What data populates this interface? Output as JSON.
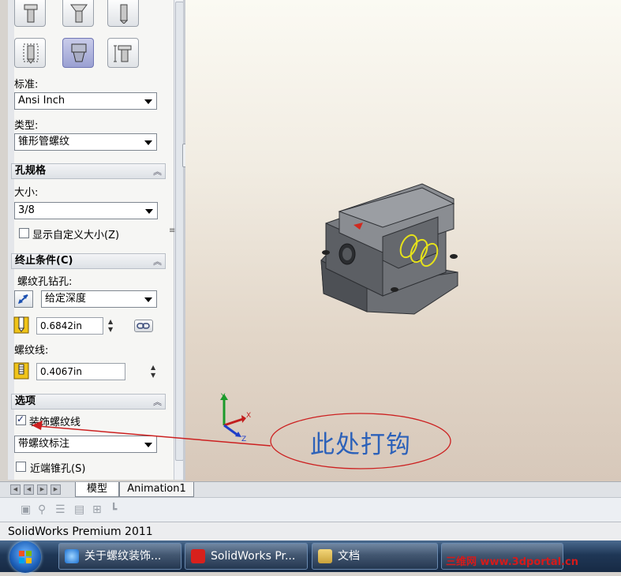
{
  "property_manager": {
    "standard_label": "标准:",
    "standard_value": "Ansi Inch",
    "type_label": "类型:",
    "type_value": "锥形管螺纹",
    "hole_spec": {
      "title": "孔规格",
      "size_label": "大小:",
      "size_value": "3/8",
      "custom_size_label": "显示自定义大小(Z)",
      "custom_size_checked": false
    },
    "end_condition": {
      "title": "终止条件(C)",
      "drill_label": "螺纹孔钻孔:",
      "drill_value": "给定深度",
      "drill_depth": "0.6842in",
      "thread_label": "螺纹线:",
      "thread_depth": "0.4067in"
    },
    "options": {
      "title": "选项",
      "cosmetic_thread_label": "装饰螺纹线",
      "cosmetic_thread_checked": true,
      "callout_value": "带螺纹标注",
      "near_csk_label": "近端锥孔(S)",
      "near_csk_checked": false
    }
  },
  "annotation": {
    "text": "此处打钩",
    "color": "#2c61b9",
    "stroke_color": "#cc2020"
  },
  "axes": {
    "x": "X",
    "y": "Y",
    "z": "Z"
  },
  "tabs": [
    {
      "label": "模型",
      "active": true
    },
    {
      "label": "Animation1",
      "active": false
    }
  ],
  "status_bar": {
    "text": "SolidWorks Premium 2011"
  },
  "taskbar": {
    "items": [
      {
        "label": "关于螺纹装饰...",
        "icon": "ie-icon"
      },
      {
        "label": "SolidWorks Pr...",
        "icon": "solidworks-icon"
      },
      {
        "label": "文档",
        "icon": "folder-icon"
      }
    ],
    "watermark": "三维网 www.3dportal.cn"
  }
}
